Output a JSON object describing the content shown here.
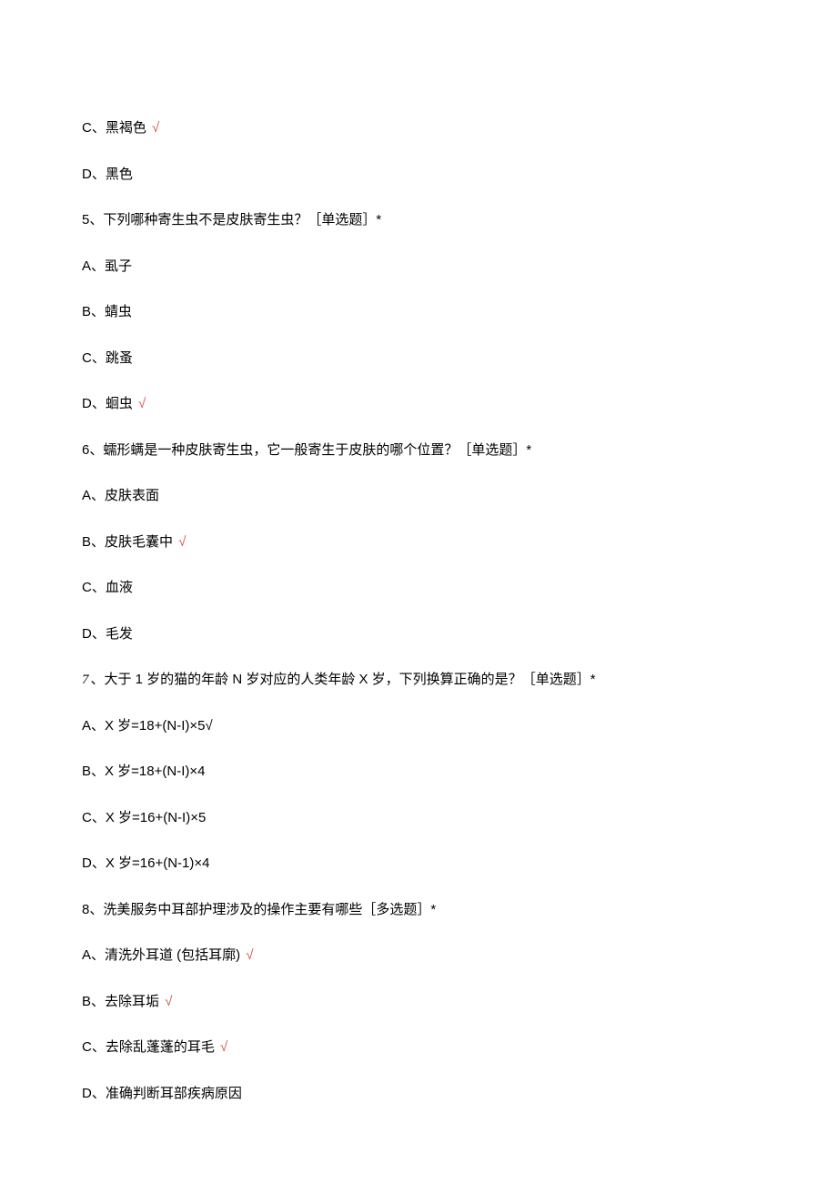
{
  "check": "√",
  "q4": {
    "optC": "C、黑褐色",
    "optD": "D、黑色"
  },
  "q5": {
    "stem": "5、下列哪种寄生虫不是皮肤寄生虫？［单选题］*",
    "optA": "A、虱子",
    "optB": "B、蜻虫",
    "optC": "C、跳蚤",
    "optD": "D、蛔虫"
  },
  "q6": {
    "stem": "6、蠕形螨是一种皮肤寄生虫，它一般寄生于皮肤的哪个位置？［单选题］*",
    "optA": "A、皮肤表面",
    "optB": "B、皮肤毛囊中",
    "optC": "C、血液",
    "optD": "D、毛发"
  },
  "q7": {
    "num": "7",
    "stem": "、大于 1 岁的猫的年龄 N 岁对应的人类年龄 X 岁，下列换算正确的是？［单选题］*",
    "optA": "A、X 岁=18+(N-I)×5√",
    "optB": "B、X 岁=18+(N-I)×4",
    "optC": "C、X 岁=16+(N-I)×5",
    "optD": "D、X 岁=16+(N-1)×4"
  },
  "q8": {
    "stem": "8、洗美服务中耳部护理涉及的操作主要有哪些［多选题］*",
    "optA": "A、清洗外耳道 (包括耳廓)",
    "optB": "B、去除耳垢",
    "optC": "C、去除乱蓬蓬的耳毛",
    "optD": "D、准确判断耳部疾病原因"
  }
}
